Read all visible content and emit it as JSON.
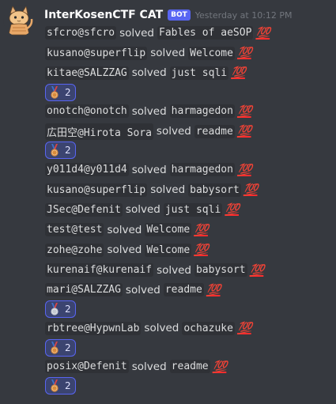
{
  "header": {
    "username": "InterKosenCTF CAT",
    "bot_tag": "BOT",
    "timestamp": "Yesterday at 10:12 PM"
  },
  "solved_word": "solved",
  "emoji": "💯",
  "medal_colors": {
    "bronze": "#d98b3a",
    "silver": "#c4c9d0",
    "ribbon": "#3c72c9"
  },
  "entries": [
    {
      "user": "sfcro@sfcro",
      "challenge": "Fables of aeSOP"
    },
    {
      "user": "kusano@superflip",
      "challenge": "Welcome"
    },
    {
      "user": "kitae@SALZZAG",
      "challenge": "just sqli",
      "reaction": {
        "medal": "bronze",
        "count": "2"
      }
    },
    {
      "user": "onotch@onotch",
      "challenge": "harmagedon"
    },
    {
      "user": "広田空@Hirota Sora",
      "challenge": "readme",
      "reaction": {
        "medal": "bronze",
        "count": "2"
      }
    },
    {
      "user": "y011d4@y011d4",
      "challenge": "harmagedon"
    },
    {
      "user": "kusano@superflip",
      "challenge": "babysort"
    },
    {
      "user": "JSec@Defenit",
      "challenge": "just sqli"
    },
    {
      "user": "test@test",
      "challenge": "Welcome"
    },
    {
      "user": "zohe@zohe",
      "challenge": "Welcome"
    },
    {
      "user": "kurenaif@kurenaif",
      "challenge": "babysort"
    },
    {
      "user": "mari@SALZZAG",
      "challenge": "readme",
      "reaction": {
        "medal": "silver",
        "count": "2"
      }
    },
    {
      "user": "rbtree@HypwnLab",
      "challenge": "ochazuke",
      "reaction": {
        "medal": "bronze",
        "count": "2"
      }
    },
    {
      "user": "posix@Defenit",
      "challenge": "readme",
      "reaction": {
        "medal": "bronze",
        "count": "2"
      }
    }
  ]
}
